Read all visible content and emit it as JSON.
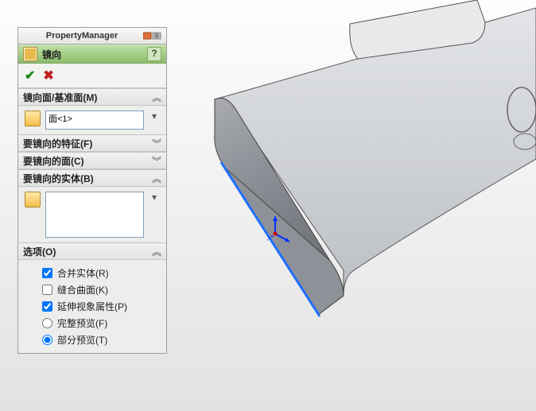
{
  "header": {
    "title": "PropertyManager"
  },
  "feature": {
    "title": "镜向",
    "help_label": "?"
  },
  "sections": {
    "mirror_plane": {
      "title": "镜向面/基准面(M)",
      "selection": "面<1>"
    },
    "features": {
      "title": "要镜向的特征(F)"
    },
    "faces": {
      "title": "要镜向的面(C)"
    },
    "bodies": {
      "title": "要镜向的实体(B)",
      "selection": ""
    },
    "options": {
      "title": "选项(O)",
      "merge": {
        "label": "合并实体(R)",
        "checked": true
      },
      "knit": {
        "label": "缝合曲面(K)",
        "checked": false
      },
      "propagate": {
        "label": "延伸视象属性(P)",
        "checked": true
      },
      "full_preview": {
        "label": "完整预览(F)",
        "selected": false
      },
      "partial_preview": {
        "label": "部分预览(T)",
        "selected": true
      }
    }
  }
}
